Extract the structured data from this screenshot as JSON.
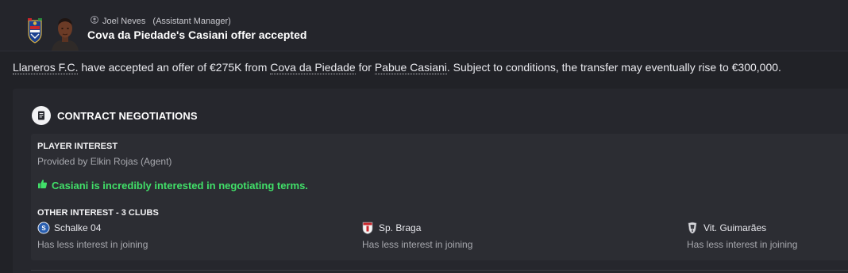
{
  "header": {
    "sender_name": "Joel Neves",
    "sender_role": "(Assistant Manager)",
    "subject": "Cova da Piedade's Casiani offer accepted",
    "icons": {
      "club_badge": "club-badge-icon",
      "avatar": "avatar",
      "person": "person-icon"
    }
  },
  "body": {
    "selling_club": "Llaneros F.C.",
    "text_1": " have accepted an offer of €275K from ",
    "buying_club": "Cova da Piedade",
    "text_2": " for ",
    "player": "Pabue Casiani",
    "text_3": ". Subject to conditions, the transfer may eventually rise to €300,000."
  },
  "contract": {
    "title": "CONTRACT NEGOTIATIONS",
    "player_interest_label": "PLAYER INTEREST",
    "provided_by": "Provided by Elkin Rojas (Agent)",
    "interest_statement": "Casiani is incredibly interested in negotiating terms.",
    "other_interest_label": "OTHER INTEREST - 3 CLUBS",
    "clubs": [
      {
        "name": "Schalke 04",
        "note": "Has less interest in joining",
        "crest": "schalke-crest-icon"
      },
      {
        "name": "Sp. Braga",
        "note": "Has less interest in joining",
        "crest": "braga-crest-icon"
      },
      {
        "name": "Vit. Guimarães",
        "note": "Has less interest in joining",
        "crest": "guimaraes-crest-icon"
      }
    ]
  },
  "colors": {
    "background": "#212227",
    "panel": "#26272d",
    "inner_panel": "#2c2d33",
    "positive": "#41e069",
    "muted_text": "#a7a8ae"
  }
}
